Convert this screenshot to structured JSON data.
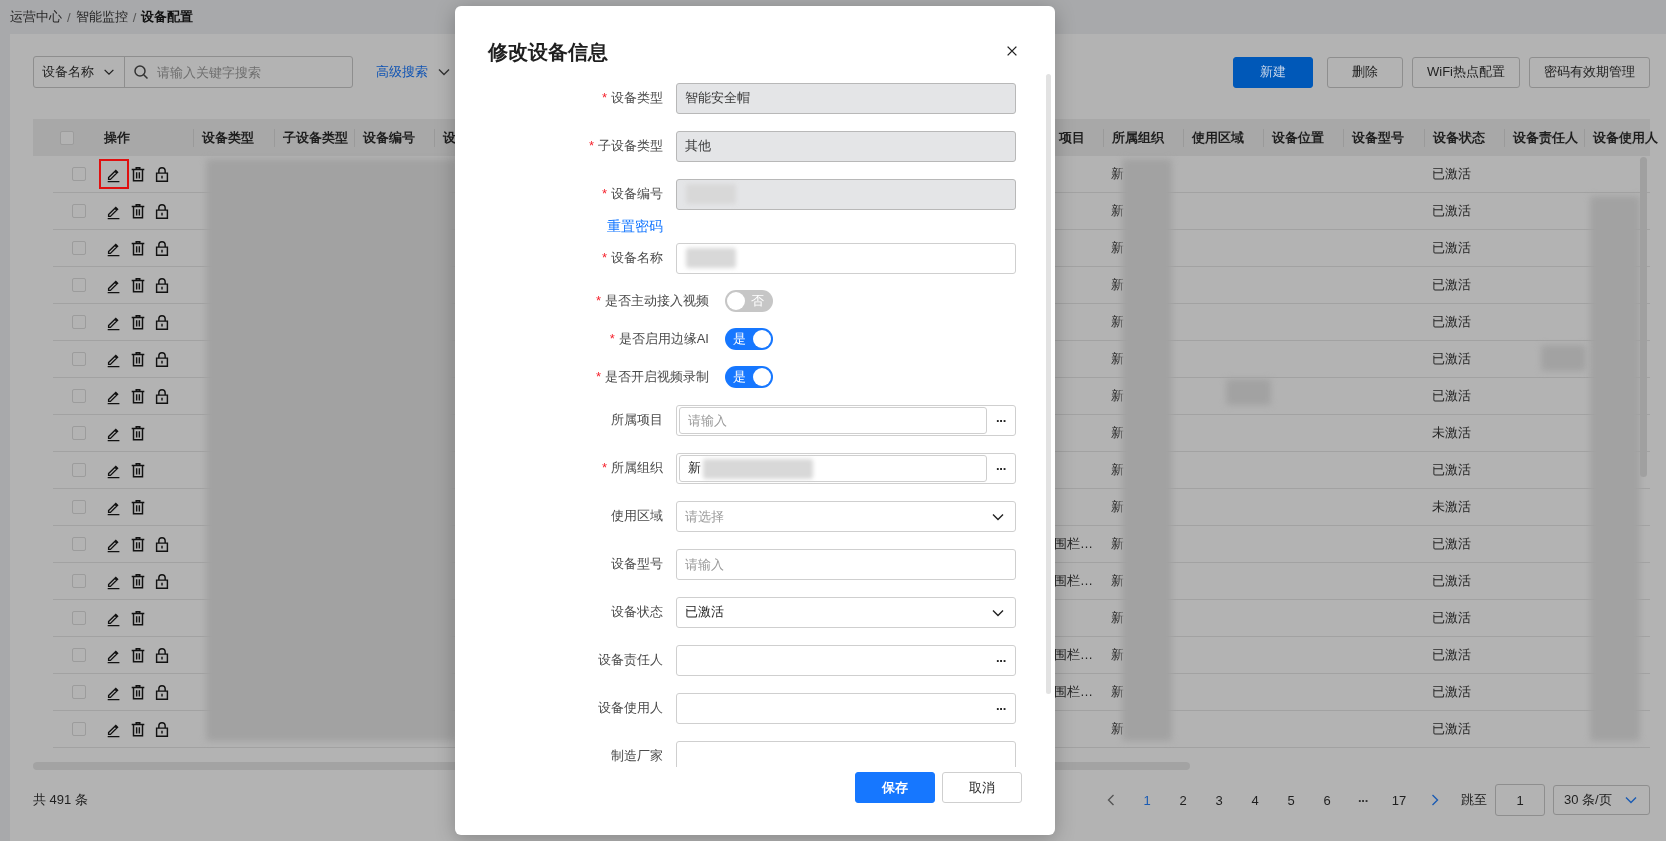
{
  "breadcrumb": [
    {
      "label": "运营中心",
      "kind": "link"
    },
    {
      "label": "/",
      "kind": "separator"
    },
    {
      "label": "智能监控",
      "kind": "link"
    },
    {
      "label": "/",
      "kind": "separator"
    },
    {
      "label": "设备配置",
      "kind": "current"
    }
  ],
  "search": {
    "field_select": "设备名称",
    "placeholder": "请输入关键字搜索",
    "advanced": "高级搜索"
  },
  "actions": [
    {
      "label": "新建",
      "kind": "primary"
    },
    {
      "label": "删除",
      "kind": "default"
    },
    {
      "label": "WiFi热点配置",
      "kind": "default"
    },
    {
      "label": "密码有效期管理",
      "kind": "default"
    }
  ],
  "table": {
    "select_all_checked": false,
    "columns": [
      "操作",
      "设备类型",
      "子设备类型",
      "设备编号",
      "设",
      "项目",
      "所属组织",
      "使用区域",
      "设备位置",
      "设备型号",
      "设备状态",
      "设备责任人",
      "设备使用人"
    ],
    "rows": [
      {
        "checked": false,
        "edit_highlighted": true,
        "lock": true,
        "org": "新",
        "status": "已激活"
      },
      {
        "checked": false,
        "edit_highlighted": false,
        "lock": true,
        "org": "新",
        "status": "已激活"
      },
      {
        "checked": false,
        "edit_highlighted": false,
        "lock": true,
        "org": "新",
        "status": "已激活"
      },
      {
        "checked": false,
        "edit_highlighted": false,
        "lock": true,
        "org": "新",
        "status": "已激活"
      },
      {
        "checked": false,
        "edit_highlighted": false,
        "lock": true,
        "org": "新",
        "status": "已激活"
      },
      {
        "checked": false,
        "edit_highlighted": false,
        "lock": true,
        "org": "新",
        "status": "已激活"
      },
      {
        "checked": false,
        "edit_highlighted": false,
        "lock": true,
        "org": "新",
        "status": "已激活"
      },
      {
        "checked": false,
        "edit_highlighted": false,
        "lock": false,
        "org": "新",
        "status": "未激活"
      },
      {
        "checked": false,
        "edit_highlighted": false,
        "lock": false,
        "org": "新",
        "status": "已激活"
      },
      {
        "checked": false,
        "edit_highlighted": false,
        "lock": false,
        "org": "新",
        "status": "未激活"
      },
      {
        "checked": false,
        "edit_highlighted": false,
        "lock": true,
        "project": "围栏…",
        "org": "新",
        "status": "已激活"
      },
      {
        "checked": false,
        "edit_highlighted": false,
        "lock": true,
        "project": "围栏…",
        "org": "新",
        "status": "已激活"
      },
      {
        "checked": false,
        "edit_highlighted": false,
        "lock": false,
        "org": "新",
        "status": "已激活"
      },
      {
        "checked": false,
        "edit_highlighted": false,
        "lock": true,
        "project": "围栏…",
        "org": "新",
        "status": "已激活"
      },
      {
        "checked": false,
        "edit_highlighted": false,
        "lock": true,
        "project": "围栏…",
        "org": "新",
        "status": "已激活"
      },
      {
        "checked": false,
        "edit_highlighted": false,
        "lock": true,
        "org": "新",
        "status": "已激活"
      }
    ]
  },
  "footer": {
    "total": "共 491 条",
    "pages": [
      {
        "label": "1",
        "kind": "page",
        "selected": true
      },
      {
        "label": "2",
        "kind": "page",
        "selected": false
      },
      {
        "label": "3",
        "kind": "page",
        "selected": false
      },
      {
        "label": "4",
        "kind": "page",
        "selected": false
      },
      {
        "label": "5",
        "kind": "page",
        "selected": false
      },
      {
        "label": "6",
        "kind": "page",
        "selected": false
      },
      {
        "label": "···",
        "kind": "ellipsis",
        "selected": false
      },
      {
        "label": "17",
        "kind": "page",
        "selected": false
      }
    ],
    "jump_label": "跳至",
    "jump_value": "1",
    "page_size": "30 条/页"
  },
  "dialog": {
    "title": "修改设备信息",
    "fields": [
      {
        "kind": "input",
        "label": "设备类型",
        "required_mark": "*",
        "value": "智能安全帽",
        "disabled": true
      },
      {
        "kind": "input",
        "label": "子设备类型",
        "required_mark": "*",
        "value": "其他",
        "disabled": true
      },
      {
        "kind": "input",
        "label": "设备编号",
        "required_mark": "*",
        "disabled": true,
        "redacted": true
      },
      {
        "kind": "link",
        "label": "重置密码"
      },
      {
        "kind": "input",
        "label": "设备名称",
        "required_mark": "*",
        "disabled": false,
        "redacted": true
      },
      {
        "kind": "switch",
        "label": "是否主动接入视频",
        "required_mark": "*",
        "on": false,
        "text": "否"
      },
      {
        "kind": "switch",
        "label": "是否启用边缘AI",
        "required_mark": "*",
        "on": true,
        "text": "是"
      },
      {
        "kind": "switch",
        "label": "是否开启视频录制",
        "required_mark": "*",
        "on": true,
        "text": "是"
      },
      {
        "kind": "picker",
        "label": "所属项目",
        "placeholder": "请输入",
        "button": "···",
        "inner_box": true
      },
      {
        "kind": "picker",
        "label": "所属组织",
        "required_mark": "*",
        "value": "新",
        "button": "···",
        "inner_box": true,
        "redacted": true
      },
      {
        "kind": "select",
        "label": "使用区域",
        "placeholder": "请选择"
      },
      {
        "kind": "input",
        "label": "设备型号",
        "placeholder": "请输入",
        "disabled": false
      },
      {
        "kind": "select",
        "label": "设备状态",
        "value": "已激活"
      },
      {
        "kind": "picker",
        "label": "设备责任人",
        "button": "···",
        "inner_box": false
      },
      {
        "kind": "picker",
        "label": "设备使用人",
        "button": "···",
        "inner_box": false
      },
      {
        "kind": "input",
        "label": "制造厂家",
        "disabled": false
      }
    ],
    "buttons": [
      {
        "label": "保存",
        "kind": "primary"
      },
      {
        "label": "取消",
        "kind": "default"
      }
    ]
  }
}
